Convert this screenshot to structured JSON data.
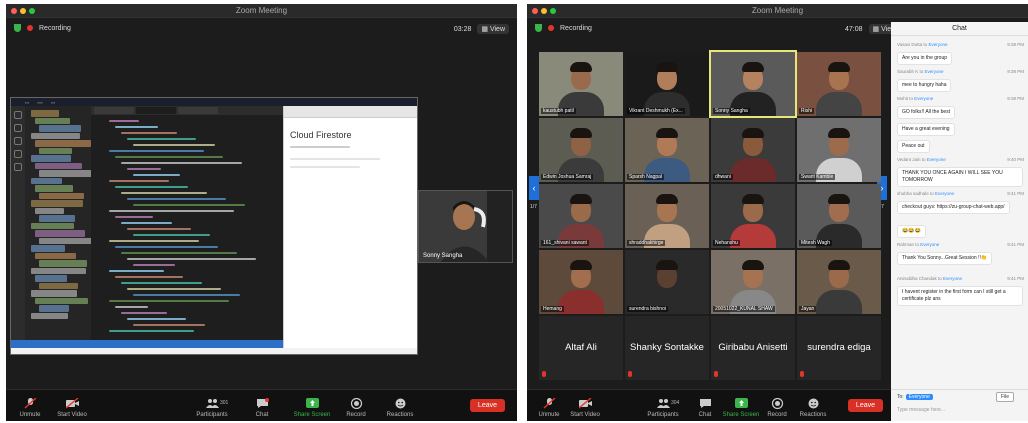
{
  "left_window": {
    "title": "Zoom Meeting",
    "recording": "Recording",
    "timer": "03:28",
    "view": "View",
    "camera_name": "Sonny Sangha",
    "toolbar": {
      "unmute": "Unmute",
      "start_video": "Start Video",
      "participants": "Participants",
      "participants_count": "301",
      "chat": "Chat",
      "share_screen": "Share Screen",
      "record": "Record",
      "reactions": "Reactions",
      "leave": "Leave"
    },
    "shared_screen": {
      "browser_title": "Cloud Firestore"
    }
  },
  "right_window": {
    "title": "Zoom Meeting",
    "recording": "Recording",
    "timer": "47:08",
    "view": "View",
    "page_left": "1/7",
    "page_right": "1/7",
    "tiles": [
      {
        "name": "kaustubh patil",
        "skin": "#9a6a4c",
        "shirt": "#3a3a3a",
        "bg": "#8a8a7a"
      },
      {
        "name": "Vikrant Deshmukh (Ex...",
        "skin": "#b07e5a",
        "shirt": "#2d2d2d",
        "bg": "#1a1a1a"
      },
      {
        "name": "Sonny Sangha",
        "skin": "#b4825f",
        "shirt": "#222",
        "bg": "#5a5a5a",
        "selected": true
      },
      {
        "name": "Rishi",
        "skin": "#a8734f",
        "shirt": "#444",
        "bg": "#7a5040"
      },
      {
        "name": "Edwin Joshua Samraj",
        "skin": "#8f6246",
        "shirt": "#3b3b3b",
        "bg": "#5c5c52"
      },
      {
        "name": "Sparsh Nagpal",
        "skin": "#b17a56",
        "shirt": "#3d5a80",
        "bg": "#6b6456"
      },
      {
        "name": "dhwani",
        "skin": "#8a5a3c",
        "shirt": "#6b2b2b",
        "bg": "#3b3b3b"
      },
      {
        "name": "Swarit Kamble",
        "skin": "#9c6b4c",
        "shirt": "#d0d0d0",
        "bg": "#6f6f6f"
      },
      {
        "name": "161_shivani sawant",
        "skin": "#9a6a4a",
        "shirt": "#7a3a3a",
        "bg": "#4a4a4a"
      },
      {
        "name": "shraddhakhirge",
        "skin": "#a87552",
        "shirt": "#c0a080",
        "bg": "#6a6055"
      },
      {
        "name": "Nehanshu",
        "skin": "#9b6a4a",
        "shirt": "#b53a3a",
        "bg": "#3a3a3a"
      },
      {
        "name": "Mitesh Wagh",
        "skin": "#a06e4e",
        "shirt": "#2a2a2a",
        "bg": "#5a5a5a"
      },
      {
        "name": "Hemang",
        "skin": "#a26e4e",
        "shirt": "#8a2e2e",
        "bg": "#5e4a3a"
      },
      {
        "name": "surendra bishnoi",
        "skin": "#5a4030",
        "shirt": "#2a2a2a",
        "bg": "#2a2a2a"
      },
      {
        "name": "20051022_KUNAL SHAW",
        "skin": "#a57252",
        "shirt": "#888",
        "bg": "#7a7065"
      },
      {
        "name": "Jayan",
        "skin": "#9a6a4a",
        "shirt": "#3a3a3a",
        "bg": "#6a5a4a"
      }
    ],
    "blank_tiles": [
      "Altaf Ali",
      "Shanky Sontakke",
      "Giribabu Anisetti",
      "surendra ediga"
    ],
    "toolbar": {
      "unmute": "Unmute",
      "start_video": "Start Video",
      "participants": "Participants",
      "participants_count": "304",
      "chat": "Chat",
      "share_screen": "Share Screen",
      "record": "Record",
      "reactions": "Reactions",
      "leave": "Leave"
    }
  },
  "chat": {
    "title": "Chat",
    "messages": [
      {
        "from": "Vasavi Dutta",
        "to": "Everyone",
        "time": "9:38 PM",
        "text": "Are you in the group"
      },
      {
        "from": "Saurabh K",
        "to": "Everyone",
        "time": "9:38 PM",
        "text": "mee to hungry haha"
      },
      {
        "from": "Mohit",
        "to": "Everyone",
        "time": "9:38 PM",
        "text": "GO folks!! All the best"
      },
      {
        "from": "",
        "to": "",
        "time": "",
        "text": "Have a great evening"
      },
      {
        "from": "",
        "to": "",
        "time": "",
        "text": "Peace out"
      },
      {
        "from": "Vedant Jain",
        "to": "Everyone",
        "time": "9:40 PM",
        "text": "THANK YOU ONCE AGAIN I WILL SEE YOU TOMORROW"
      },
      {
        "from": "shubha sadhale",
        "to": "Everyone",
        "time": "9:41 PM",
        "text": "checkout guys: https://zu-group-chat-web.app/"
      },
      {
        "from": "",
        "to": "",
        "time": "",
        "text": "😂😂😂"
      },
      {
        "from": "Rahman",
        "to": "Everyone",
        "time": "9:41 PM",
        "text": "Thank You Sonny...Great Session !!👏"
      },
      {
        "from": "Aniruddha Chandak",
        "to": "Everyone",
        "time": "9:41 PM",
        "text": "I havent register in the first form can I still get a certificate plz ans"
      }
    ],
    "to_label": "To:",
    "to_value": "Everyone",
    "file_button": "File",
    "placeholder": "Type message here..."
  }
}
